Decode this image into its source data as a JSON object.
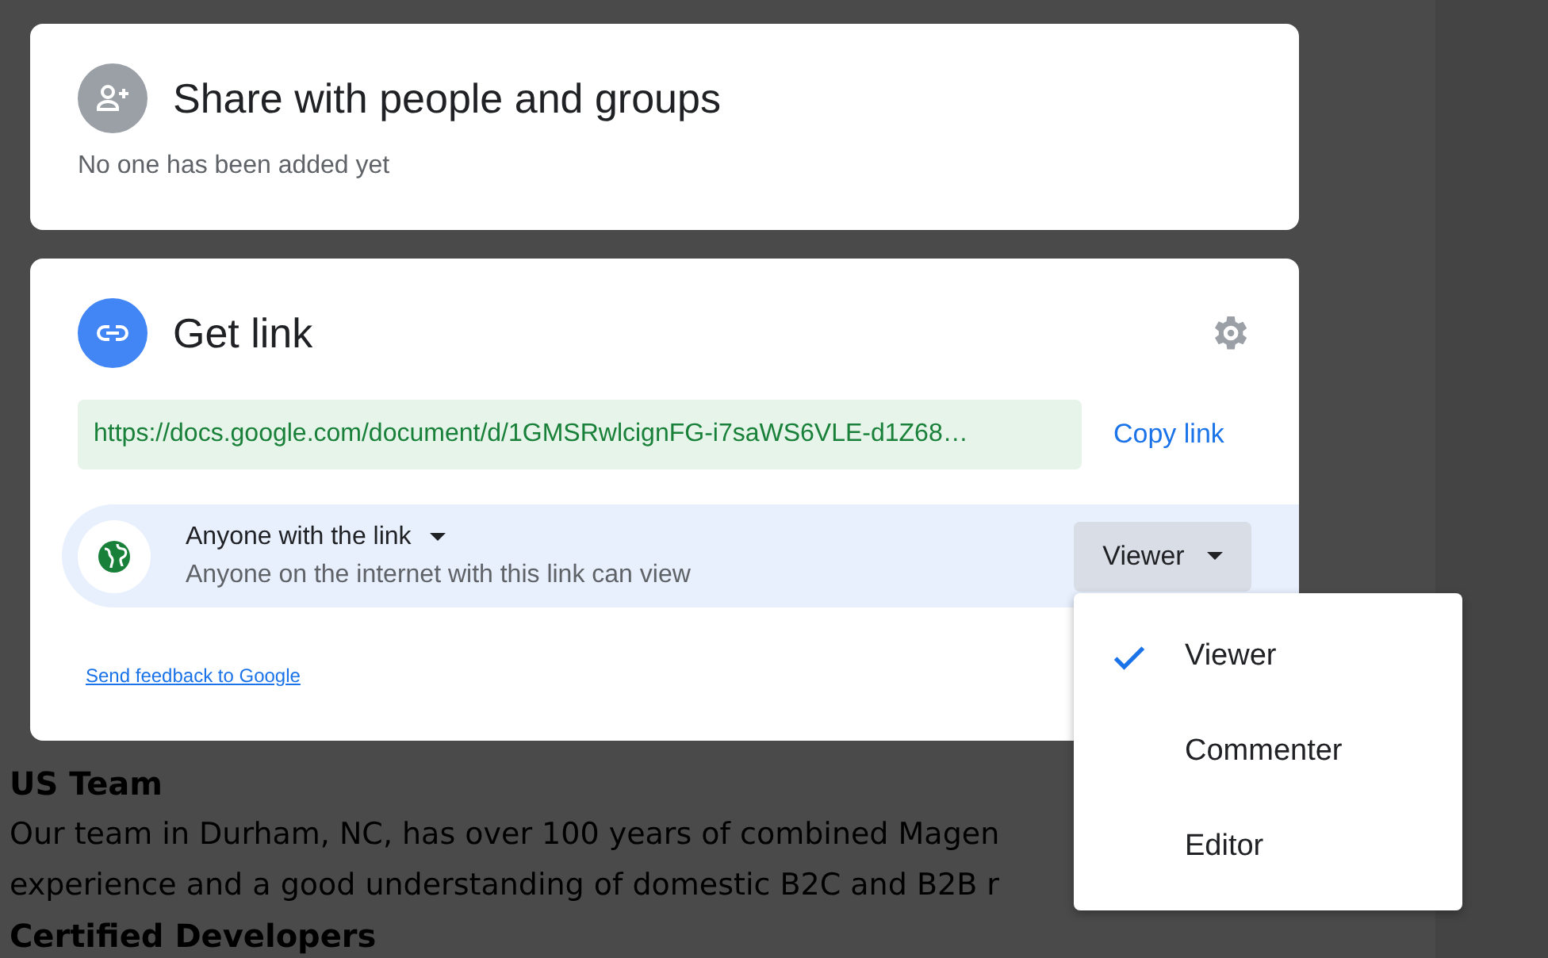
{
  "background_document": [
    {
      "kind": "heading",
      "text": "US Team"
    },
    {
      "kind": "paragraph",
      "text": "Our team in Durham, NC, has over 100 years of combined Magen"
    },
    {
      "kind": "paragraph",
      "text": "experience and a good understanding of domestic B2C and B2B r"
    },
    {
      "kind": "heading",
      "text": "Certified Developers"
    }
  ],
  "share_panel": {
    "title": "Share with people and groups",
    "status": "No one has been added yet"
  },
  "link_panel": {
    "title": "Get link",
    "url": "https://docs.google.com/document/d/1GMSRwlcignFG-i7saWS6VLE-d1Z68…",
    "copy_button": "Copy link",
    "access": {
      "label": "Anyone with the link",
      "description": "Anyone on the internet with this link can view",
      "role": "Viewer"
    },
    "feedback_link": "Send feedback to Google"
  },
  "role_menu": [
    {
      "label": "Viewer",
      "selected": true
    },
    {
      "label": "Commenter",
      "selected": false
    },
    {
      "label": "Editor",
      "selected": false
    }
  ]
}
